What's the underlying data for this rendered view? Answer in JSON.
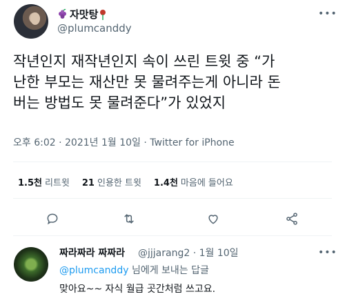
{
  "tweet": {
    "display_name": "자맛탕",
    "handle": "@plumcanddy",
    "text_lines": [
      "작년인지 재작년인지 속이 쓰린 트윗 중 “가",
      "난한 부모는 재산만 못 물려주는게 아니라 돈",
      "버는 방법도 못 물려준다”가 있었지"
    ],
    "time": "오후 6:02",
    "date": "2021년 1월 10일",
    "app": "Twitter for iPhone",
    "more": "•••"
  },
  "stats": {
    "retweets_count": "1.5천",
    "retweets_label": "리트윗",
    "quotes_count": "21",
    "quotes_label": "인용한 트윗",
    "likes_count": "1.4천",
    "likes_label": "마음에 들어요"
  },
  "icons": [
    "reply-icon",
    "retweet-icon",
    "like-icon",
    "share-icon",
    "grape-icon",
    "rose-icon"
  ],
  "reply": {
    "display_name": "짜라짜라 짜짜라",
    "handle": "@jjjarang2",
    "date": "1월 10일",
    "to_mention": "@plumcanddy",
    "to_suffix": "님에게 보내는 답글",
    "text": "맞아요~~ 자식 월급 곳간처럼 쓰고요.",
    "more": "•••"
  },
  "colors": {
    "accent": "#1d9bf0",
    "secondary_text": "#536471",
    "divider": "#eff3f4"
  }
}
